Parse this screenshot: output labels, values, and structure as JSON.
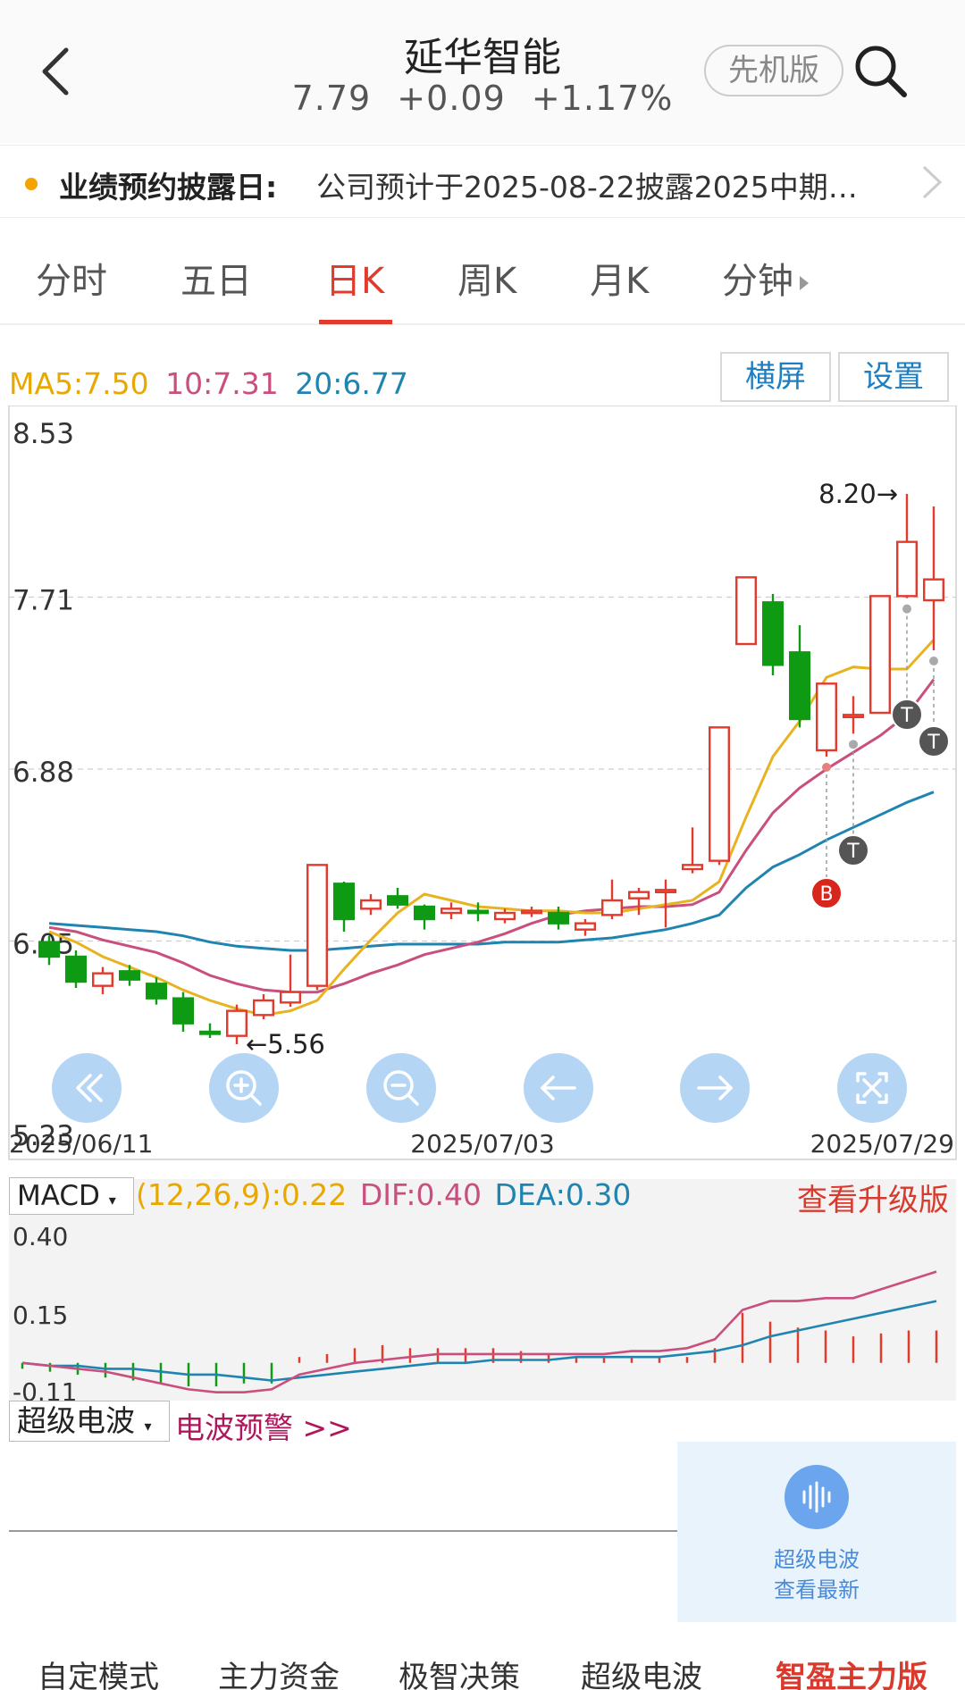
{
  "header": {
    "title": "延华智能",
    "price": "7.79",
    "change": "+0.09",
    "change_pct": "+1.17%",
    "pioneer_label": "先机版"
  },
  "notice": {
    "label": "业绩预约披露日:",
    "text": "公司预计于2025-08-22披露2025中期…"
  },
  "tabs": [
    {
      "label": "分时"
    },
    {
      "label": "五日"
    },
    {
      "label": "日K"
    },
    {
      "label": "周K"
    },
    {
      "label": "月K"
    },
    {
      "label": "分钟"
    }
  ],
  "ma": {
    "ma5": "MA5:7.50",
    "ma10": "10:7.31",
    "ma20": "20:6.77",
    "landscape_btn": "横屏",
    "settings_btn": "设置"
  },
  "colors": {
    "up": "#e23b2e",
    "down": "#0e9a12",
    "ma5": "#e8b320",
    "ma10": "#c94f7e",
    "ma20": "#1f85b0"
  },
  "chart_data": [
    {
      "type": "candlestick",
      "y_ticks": [
        "8.53",
        "7.71",
        "6.88",
        "6.05",
        "5.23"
      ],
      "ylim": [
        5.23,
        8.53
      ],
      "x_ticks": [
        "2025/06/11",
        "2025/07/03",
        "2025/07/29"
      ],
      "high_label": "8.20→",
      "low_label": "←5.56",
      "markers": [
        "B",
        "T",
        "T",
        "T"
      ],
      "candles": [
        {
          "o": 6.05,
          "c": 5.98,
          "h": 6.08,
          "l": 5.94
        },
        {
          "o": 5.98,
          "c": 5.86,
          "h": 6.01,
          "l": 5.83
        },
        {
          "o": 5.84,
          "c": 5.9,
          "h": 5.93,
          "l": 5.8
        },
        {
          "o": 5.91,
          "c": 5.87,
          "h": 5.94,
          "l": 5.84
        },
        {
          "o": 5.85,
          "c": 5.78,
          "h": 5.88,
          "l": 5.75
        },
        {
          "o": 5.78,
          "c": 5.66,
          "h": 5.81,
          "l": 5.62
        },
        {
          "o": 5.62,
          "c": 5.61,
          "h": 5.66,
          "l": 5.59
        },
        {
          "o": 5.6,
          "c": 5.72,
          "h": 5.75,
          "l": 5.56
        },
        {
          "o": 5.7,
          "c": 5.77,
          "h": 5.8,
          "l": 5.68
        },
        {
          "o": 5.76,
          "c": 5.81,
          "h": 5.99,
          "l": 5.74
        },
        {
          "o": 5.84,
          "c": 6.42,
          "h": 6.42,
          "l": 5.82
        },
        {
          "o": 6.33,
          "c": 6.16,
          "h": 6.34,
          "l": 6.1
        },
        {
          "o": 6.21,
          "c": 6.25,
          "h": 6.28,
          "l": 6.18
        },
        {
          "o": 6.27,
          "c": 6.23,
          "h": 6.31,
          "l": 6.21
        },
        {
          "o": 6.22,
          "c": 6.16,
          "h": 6.23,
          "l": 6.11
        },
        {
          "o": 6.19,
          "c": 6.21,
          "h": 6.24,
          "l": 6.16
        },
        {
          "o": 6.2,
          "c": 6.19,
          "h": 6.24,
          "l": 6.15
        },
        {
          "o": 6.16,
          "c": 6.19,
          "h": 6.21,
          "l": 6.14
        },
        {
          "o": 6.19,
          "c": 6.2,
          "h": 6.22,
          "l": 6.17
        },
        {
          "o": 6.19,
          "c": 6.14,
          "h": 6.22,
          "l": 6.11
        },
        {
          "o": 6.11,
          "c": 6.14,
          "h": 6.16,
          "l": 6.08
        },
        {
          "o": 6.18,
          "c": 6.25,
          "h": 6.35,
          "l": 6.16
        },
        {
          "o": 6.26,
          "c": 6.29,
          "h": 6.31,
          "l": 6.18
        },
        {
          "o": 6.29,
          "c": 6.3,
          "h": 6.35,
          "l": 6.12
        },
        {
          "o": 6.4,
          "c": 6.42,
          "h": 6.6,
          "l": 6.38
        },
        {
          "o": 6.44,
          "c": 7.08,
          "h": 7.08,
          "l": 6.42
        },
        {
          "o": 7.48,
          "c": 7.8,
          "h": 7.8,
          "l": 7.48
        },
        {
          "o": 7.68,
          "c": 7.38,
          "h": 7.72,
          "l": 7.33
        },
        {
          "o": 7.44,
          "c": 7.12,
          "h": 7.57,
          "l": 7.08
        },
        {
          "o": 6.97,
          "c": 7.29,
          "h": 7.29,
          "l": 6.94
        },
        {
          "o": 7.14,
          "c": 7.14,
          "h": 7.23,
          "l": 7.05
        },
        {
          "o": 7.15,
          "c": 7.71,
          "h": 7.71,
          "l": 7.15
        },
        {
          "o": 7.71,
          "c": 7.97,
          "h": 8.2,
          "l": 7.7
        },
        {
          "o": 7.69,
          "c": 7.79,
          "h": 8.14,
          "l": 7.45
        }
      ],
      "ma5": [
        6.1,
        6.05,
        5.98,
        5.93,
        5.88,
        5.82,
        5.77,
        5.73,
        5.7,
        5.72,
        5.77,
        5.92,
        6.06,
        6.19,
        6.28,
        6.25,
        6.22,
        6.21,
        6.2,
        6.2,
        6.19,
        6.19,
        6.21,
        6.23,
        6.25,
        6.34,
        6.65,
        6.94,
        7.11,
        7.32,
        7.37,
        7.36,
        7.36,
        7.5
      ],
      "ma10": [
        6.12,
        6.1,
        6.06,
        6.03,
        6.0,
        5.95,
        5.89,
        5.85,
        5.82,
        5.81,
        5.81,
        5.85,
        5.9,
        5.94,
        5.99,
        6.02,
        6.05,
        6.09,
        6.14,
        6.18,
        6.2,
        6.21,
        6.22,
        6.22,
        6.23,
        6.29,
        6.49,
        6.67,
        6.79,
        6.88,
        6.96,
        7.04,
        7.14,
        7.31
      ],
      "ma20": [
        6.14,
        6.13,
        6.12,
        6.11,
        6.1,
        6.08,
        6.05,
        6.03,
        6.02,
        6.01,
        6.01,
        6.02,
        6.03,
        6.04,
        6.04,
        6.04,
        6.04,
        6.05,
        6.05,
        6.05,
        6.06,
        6.07,
        6.09,
        6.11,
        6.14,
        6.18,
        6.31,
        6.41,
        6.47,
        6.54,
        6.6,
        6.66,
        6.72,
        6.77
      ]
    },
    {
      "type": "macd",
      "y_ticks": [
        "0.40",
        "0.15",
        "-0.11"
      ],
      "ylim": [
        -0.11,
        0.4
      ],
      "macd": [
        -0.02,
        -0.03,
        -0.04,
        -0.05,
        -0.06,
        -0.07,
        -0.08,
        -0.08,
        -0.07,
        -0.07,
        0.02,
        0.03,
        0.05,
        0.06,
        0.05,
        0.05,
        0.05,
        0.05,
        0.04,
        0.03,
        0.02,
        0.02,
        0.02,
        0.02,
        0.02,
        0.05,
        0.17,
        0.14,
        0.12,
        0.11,
        0.09,
        0.1,
        0.11,
        0.11
      ],
      "dif": [
        0.0,
        -0.01,
        -0.02,
        -0.03,
        -0.05,
        -0.07,
        -0.09,
        -0.1,
        -0.1,
        -0.09,
        -0.04,
        -0.02,
        0.0,
        0.01,
        0.02,
        0.03,
        0.03,
        0.03,
        0.03,
        0.03,
        0.03,
        0.03,
        0.04,
        0.04,
        0.05,
        0.08,
        0.18,
        0.21,
        0.21,
        0.22,
        0.22,
        0.25,
        0.28,
        0.31
      ],
      "dea": [
        0.0,
        -0.01,
        -0.01,
        -0.02,
        -0.02,
        -0.03,
        -0.04,
        -0.04,
        -0.05,
        -0.06,
        -0.05,
        -0.04,
        -0.03,
        -0.02,
        -0.01,
        0.0,
        0.0,
        0.01,
        0.01,
        0.01,
        0.02,
        0.02,
        0.02,
        0.02,
        0.03,
        0.04,
        0.06,
        0.09,
        0.11,
        0.13,
        0.15,
        0.17,
        0.19,
        0.21
      ]
    }
  ],
  "overlay_controls": [
    "rewind-icon",
    "zoom-in-icon",
    "zoom-out-icon",
    "arrow-left-icon",
    "arrow-right-icon",
    "fullscreen-icon"
  ],
  "macd": {
    "selector": "MACD",
    "params": "(12,26,9):0.22",
    "dif": "DIF:0.40",
    "dea": "DEA:0.30",
    "upgrade": "查看升级版"
  },
  "wave": {
    "selector": "超级电波",
    "warning": "电波预警 >>",
    "card_line1": "超级电波",
    "card_line2": "查看最新"
  },
  "bottom_bar": [
    {
      "label": "自定模式"
    },
    {
      "label": "主力资金"
    },
    {
      "label": "极智决策"
    },
    {
      "label": "超级电波"
    },
    {
      "label": "智盈主力版"
    }
  ]
}
